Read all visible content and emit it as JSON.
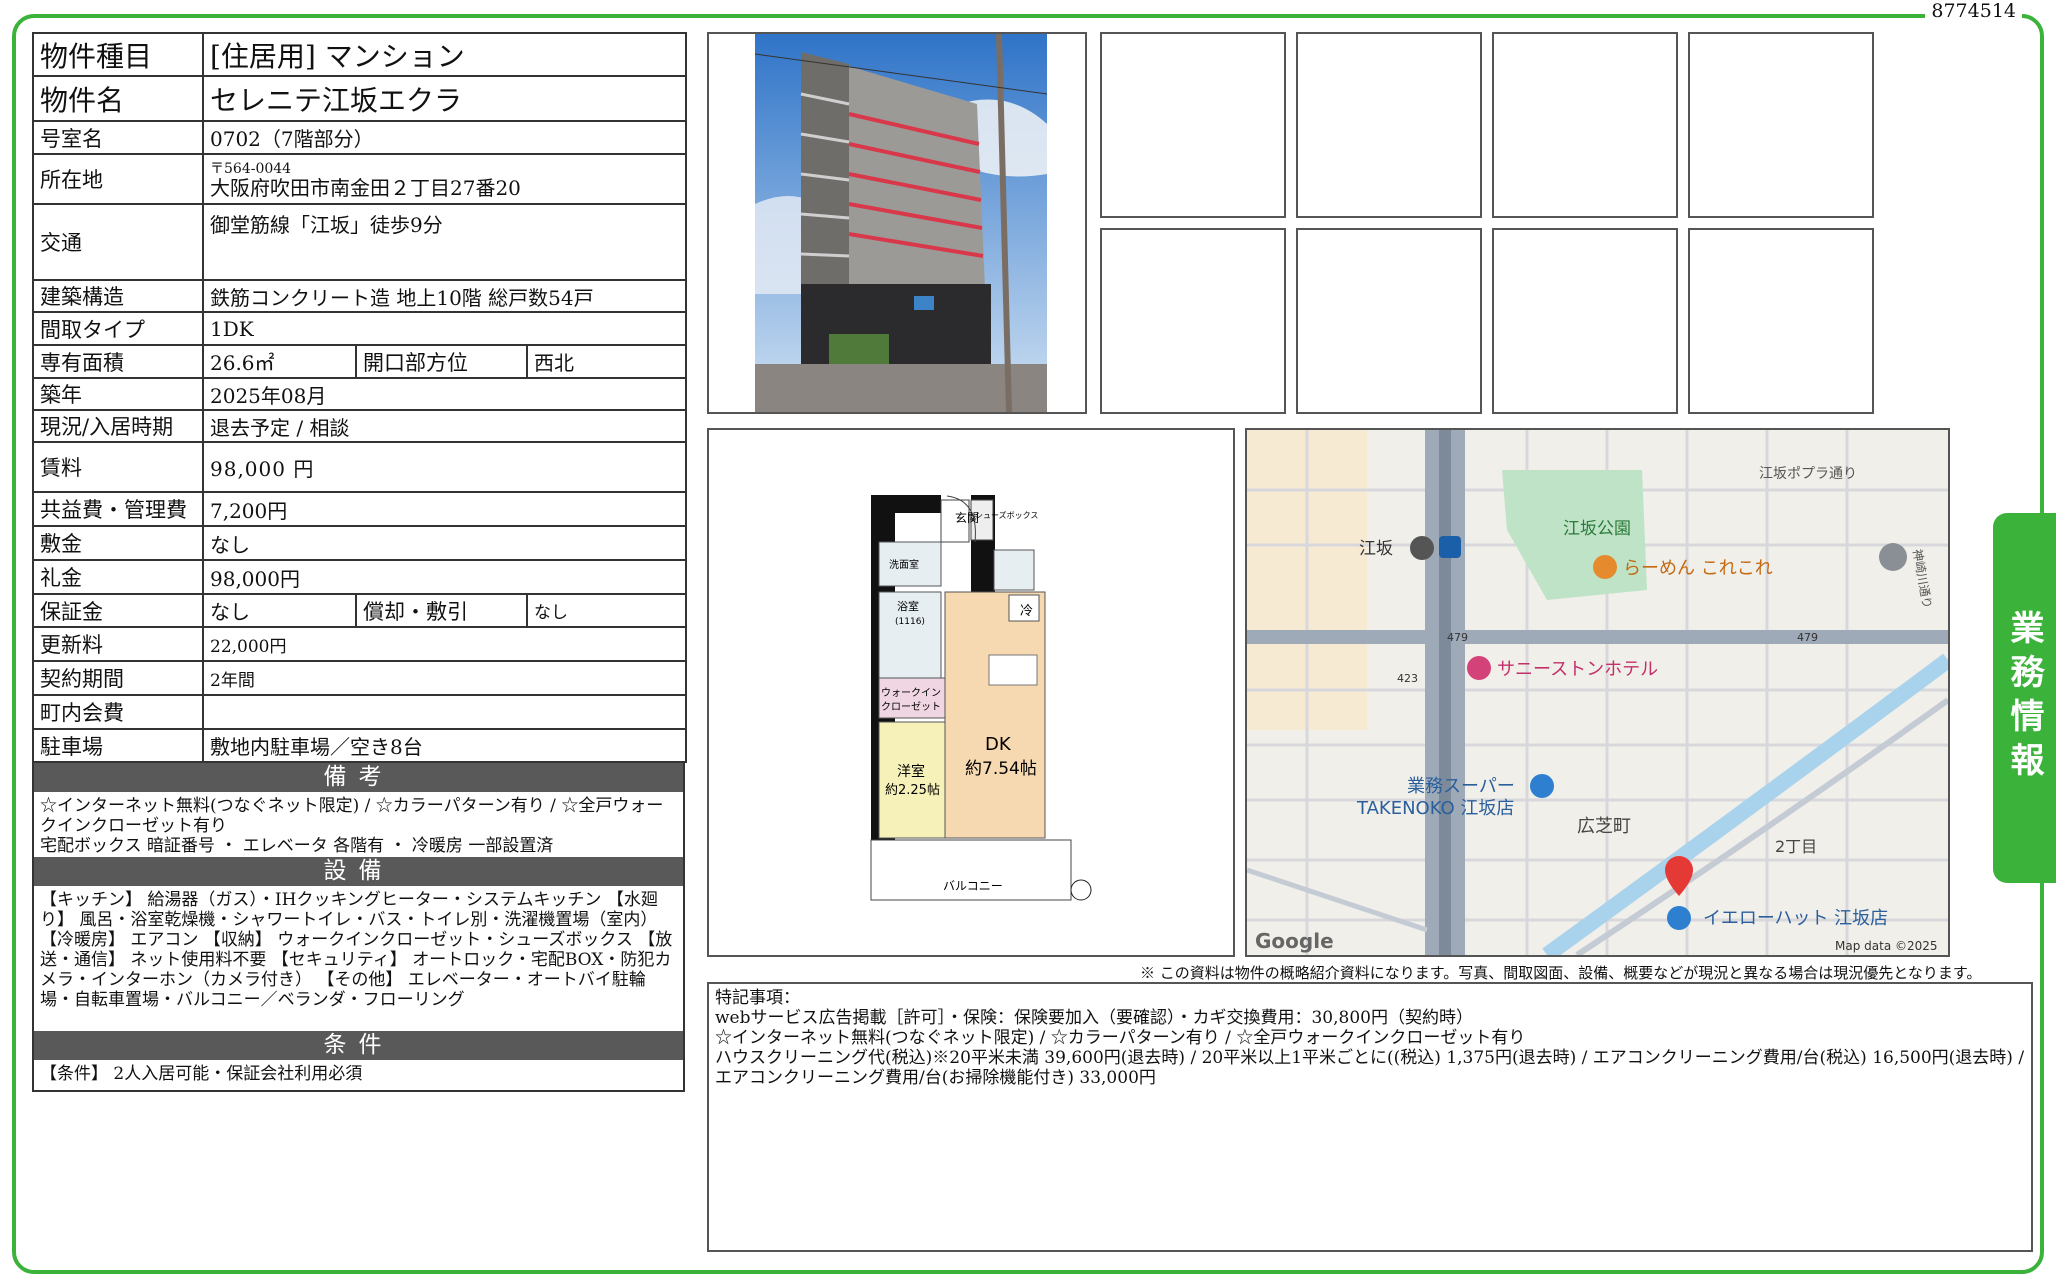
{
  "doc_id": "8774514",
  "side_tab": "業務情報",
  "property": {
    "type_label": "物件種目",
    "type_value": "[住居用]  マンション",
    "name_label": "物件名",
    "name_value": "セレニテ江坂エクラ",
    "room_label": "号室名",
    "room_value": "0702（7階部分）",
    "location_label": "所在地",
    "zip": "〒564-0044",
    "address": "大阪府吹田市南金田２丁目27番20",
    "access_label": "交通",
    "access_value": "御堂筋線「江坂」徒歩9分",
    "structure_label": "建築構造",
    "structure_value": "鉄筋コンクリート造 地上10階 総戸数54戸",
    "layout_label": "間取タイプ",
    "layout_value": "1DK",
    "area_label": "専有面積",
    "area_value": "26.6㎡",
    "direction_label": "開口部方位",
    "direction_value": "西北",
    "built_label": "築年",
    "built_value": "2025年08月",
    "status_label": "現況/入居時期",
    "status_value": "退去予定 / 相談",
    "rent_label": "賃料",
    "rent_value": "98,000 円",
    "fee_label": "共益費・管理費",
    "fee_value": "7,200円",
    "deposit_label": "敷金",
    "deposit_value": "なし",
    "keymoney_label": "礼金",
    "keymoney_value": "98,000円",
    "guarantee_label": "保証金",
    "guarantee_value": "なし",
    "amort_label": "償却・敷引",
    "amort_value": "なし",
    "renewal_label": "更新料",
    "renewal_value": "22,000円",
    "contract_label": "契約期間",
    "contract_value": "2年間",
    "community_label": "町内会費",
    "community_value": "",
    "parking_label": "駐車場",
    "parking_value": "敷地内駐車場／空き8台"
  },
  "sections": {
    "remarks_title": "備考",
    "remarks_text": "☆インターネット無料(つなぐネット限定) / ☆カラーパターン有り / ☆全戸ウォークインクローゼット有り",
    "remarks_text2": "宅配ボックス 暗証番号 ・ エレベータ 各階有 ・ 冷暖房 一部設置済",
    "equipment_title": "設備",
    "equipment_text": "【キッチン】 給湯器（ガス）・IHクッキングヒーター・システムキッチン 【水廻り】 風呂・浴室乾燥機・シャワートイレ・バス・トイレ別・洗濯機置場（室内） 【冷暖房】 エアコン 【収納】 ウォークインクローゼット・シューズボックス 【放送・通信】 ネット使用料不要 【セキュリティ】 オートロック・宅配BOX・防犯カメラ・インターホン（カメラ付き） 【その他】 エレベーター・オートバイ駐輪場・自転車置場・バルコニー／ベランダ・フローリング",
    "conditions_title": "条件",
    "conditions_text": "【条件】 2人入居可能・保証会社利用必須"
  },
  "floorplan": {
    "entrance": "玄関",
    "shoebox": "シューズボックス",
    "washer": "洗面室",
    "fridge": "冷",
    "bath": "浴室",
    "bath_size": "(1116)",
    "wic1": "ウォークイン",
    "wic2": "クローゼット",
    "western": "洋室",
    "western_size": "約2.25帖",
    "dk": "DK",
    "dk_size": "約7.54帖",
    "balcony": "バルコニー"
  },
  "map": {
    "station": "江坂",
    "park": "江坂公園",
    "ramen": "らーめん これこれ",
    "hotel": "サニーストンホテル",
    "super1": "業務スーパー",
    "super2": "TAKENOKO 江坂店",
    "town": "広芝町",
    "chome": "2丁目",
    "yellowhat": "イエローハット 江坂店",
    "poplar": "江坂ポプラ通り",
    "route479a": "479",
    "route479b": "479",
    "route423": "423",
    "google": "Google",
    "mapdata": "Map data ©2025",
    "side_road": "神崎川通り"
  },
  "note": "※ この資料は物件の概略紹介資料になります。写真、間取図面、設備、概要などが現況と異なる場合は現況優先となります。",
  "special": {
    "title": "特記事項：",
    "line1": "webサービス広告掲載［許可］・保険：保険要加入（要確認）・カギ交換費用：30,800円（契約時）",
    "line2": "☆インターネット無料(つなぐネット限定) / ☆カラーパターン有り / ☆全戸ウォークインクローゼット有り",
    "line3": "ハウスクリーニング代(税込)※20平米未満 39,600円(退去時) / 20平米以上1平米ごとに((税込) 1,375円(退去時) / エアコンクリーニング費用/台(税込) 16,500円(退去時) / エアコンクリーニング費用/台(お掃除機能付き) 33,000円"
  },
  "colors": {
    "frame": "#3bb33b",
    "section_bar": "#595959"
  }
}
